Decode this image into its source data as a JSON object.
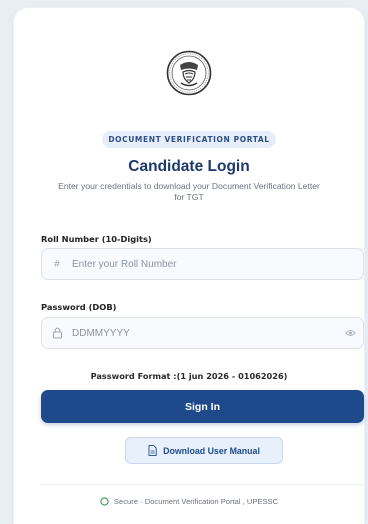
{
  "header": {
    "emblem_icon": "state-emblem-seal",
    "portal_badge": "DOCUMENT VERIFICATION PORTAL",
    "title": "Candidate Login",
    "subtitle": "Enter your credentials to download your Document Verification Letter for TGT"
  },
  "form": {
    "roll_label": "Roll Number (10-Digits)",
    "roll_icon": "#",
    "roll_placeholder": "Enter your Roll Number",
    "roll_value": "",
    "password_label": "Password (DOB)",
    "password_placeholder": "DDMMYYYY",
    "password_value": "",
    "password_format": "Password Format :(1 jun 2026 - 01062026)",
    "signin_label": "Sign In",
    "manual_label": "Download User Manual"
  },
  "footer": {
    "text": "Secure · Document Verification Portal , UPESSC"
  },
  "colors": {
    "primary": "#1e4a8c",
    "badge_bg": "#e6eefb",
    "secure_icon": "#2e9c5a"
  }
}
